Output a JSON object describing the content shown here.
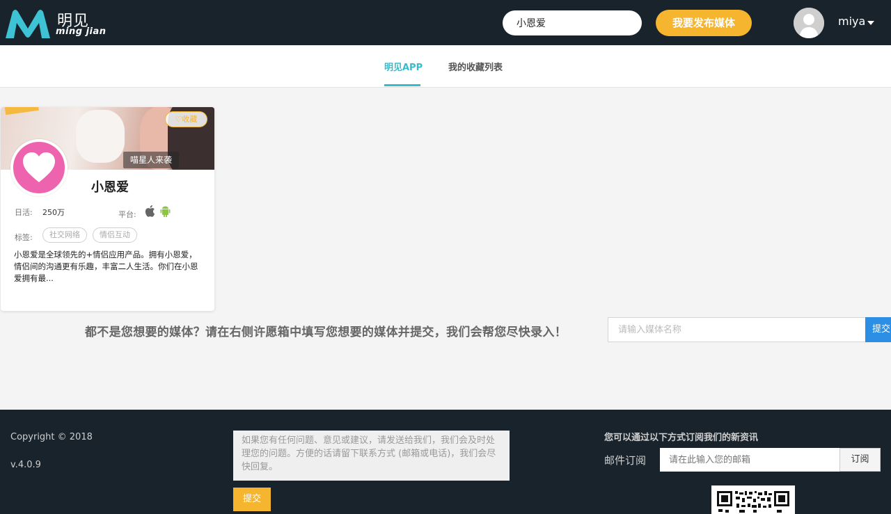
{
  "header": {
    "logo_cn": "明见",
    "logo_en": "ming jian",
    "search_value": "小恩爱",
    "publish_label": "我要发布媒体",
    "username": "miya"
  },
  "tabs": [
    {
      "label": "明见APP",
      "active": true
    },
    {
      "label": "我的收藏列表",
      "active": false
    }
  ],
  "card": {
    "banner_caption": "喵星人来袭",
    "fav_label": "♡收藏",
    "name": "小恩爱",
    "dau_label": "日活:",
    "dau_value": "250万",
    "platform_label": "平台:",
    "platform_icons": [
      "apple-icon",
      "android-icon"
    ],
    "tags_label": "标签:",
    "tags": [
      "社交网络",
      "情侣互动"
    ],
    "description": "小恩爱是全球领先的+情侣应用产品。拥有小恩爱，情侣间的沟通更有乐趣，丰富二人生活。你们在小恩爱拥有最..."
  },
  "wish": {
    "text": "都不是您想要的媒体？请在右侧许愿箱中填写您想要的媒体并提交，我们会帮您尽快录入！",
    "placeholder": "请输入媒体名称",
    "submit_label": "提交"
  },
  "footer": {
    "copyright": "Copyright © 2018",
    "version": "v.4.0.9",
    "feedback_placeholder": "如果您有任何问题、意见或建议，请发送给我们，我们会及时处理您的问题。方便的话请留下联系方式 (邮箱或电话)，我们会尽快回复。",
    "feedback_submit": "提交",
    "subscribe_title": "您可以通过以下方式订阅我们的新资讯",
    "subscribe_label": "邮件订阅",
    "email_placeholder": "请在此输入您的邮箱",
    "subscribe_button": "订阅"
  },
  "colors": {
    "header_bg": "#19232b",
    "accent_yellow": "#f6b52e",
    "accent_teal": "#36bccc",
    "accent_blue": "#2d8fe4",
    "app_icon_pink": "#ed63ad"
  }
}
